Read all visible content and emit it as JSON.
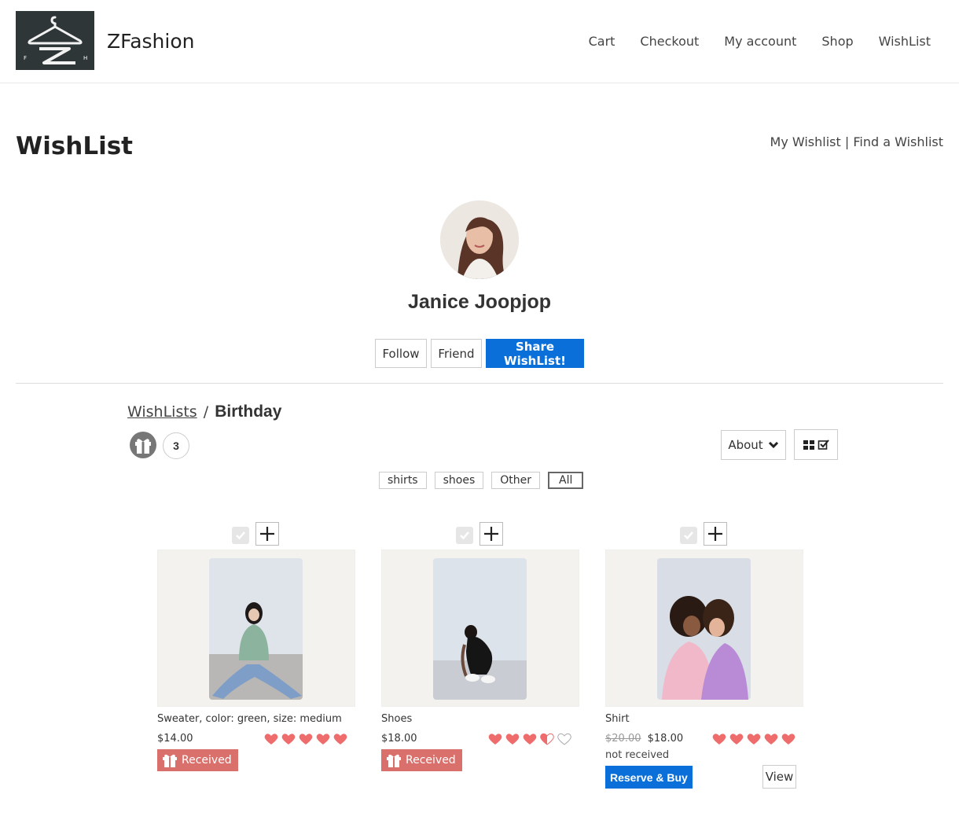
{
  "header": {
    "site_title": "ZFashion",
    "nav": [
      "Cart",
      "Checkout",
      "My account",
      "Shop",
      "WishList"
    ]
  },
  "page": {
    "title": "WishList",
    "my_wishlist": "My Wishlist",
    "separator": "|",
    "find_wishlist": "Find a Wishlist"
  },
  "profile": {
    "name": "Janice Joopjop",
    "follow_label": "Follow",
    "friend_label": "Friend",
    "share_label": "Share WishList!"
  },
  "list": {
    "breadcrumb_link": "WishLists",
    "breadcrumb_sep": "/",
    "name": "Birthday",
    "item_count": "3",
    "about_label": "About"
  },
  "filters": [
    "shirts",
    "shoes",
    "Other",
    "All"
  ],
  "active_filter": "All",
  "products": [
    {
      "name": "Sweater, color: green, size: medium",
      "price": "$14.00",
      "rating": 5,
      "status": "Received"
    },
    {
      "name": "Shoes",
      "price": "$18.00",
      "rating": 3.5,
      "status": "Received"
    },
    {
      "name": "Shirt",
      "old_price": "$20.00",
      "price": "$18.00",
      "rating": 5,
      "status_text": "not received",
      "reserve_label": "Reserve & Buy",
      "view_label": "View"
    }
  ],
  "colors": {
    "primary_blue": "#0a6fd8",
    "heart_red": "#ef6c6c",
    "received_red": "#d9706b"
  }
}
